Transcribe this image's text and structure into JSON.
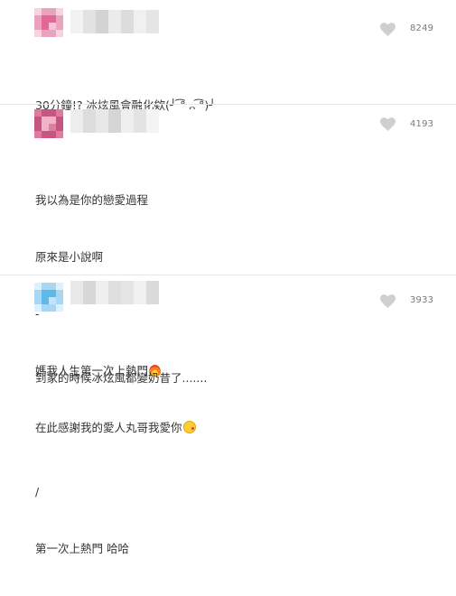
{
  "comments": [
    {
      "likes": "8249",
      "lines": [
        "30分鐘!? 冰炫風會融化欸(╯ ͡° ᎔ ͡°)╯"
      ],
      "avatar_colors": [
        "#f7d3e0",
        "#e9a3bf",
        "#e26795",
        "#f3c3d6"
      ],
      "name_colors": [
        "#f2f2f2",
        "#e2e2e2",
        "#d3d3d3",
        "#ebebeb",
        "#dcdcdc",
        "#f0f0f0",
        "#e5e5e5"
      ]
    },
    {
      "likes": "4193",
      "lines": [
        "我以為是你的戀愛過程",
        "原來是小說啊",
        "-",
        "媽我人生第一次上熱門",
        "在此感謝我的愛人丸哥我愛你"
      ],
      "emojis": [
        "fire-emoji",
        "kissing-face-emoji"
      ],
      "avatar_colors": [
        "#e07aa0",
        "#c6557f",
        "#f0b3c8",
        "#d9819f"
      ],
      "name_colors": [
        "#ededed",
        "#dddddd",
        "#e8e8e8",
        "#d5d5d5",
        "#efefef",
        "#e3e3e3",
        "#f4f4f4"
      ]
    },
    {
      "likes": "3933",
      "lines": [
        "到家的時候冰炫風都變奶昔了.......",
        "",
        "/",
        "第一次上熱門 哈哈"
      ],
      "avatar_colors": [
        "#dff0fb",
        "#a7d7f2",
        "#5fb8e6",
        "#c3e4f7"
      ],
      "name_colors": [
        "#e9e9e9",
        "#d7d7d7",
        "#efefef",
        "#dedede",
        "#e4e4e4",
        "#f1f1f1",
        "#dadada"
      ]
    }
  ]
}
